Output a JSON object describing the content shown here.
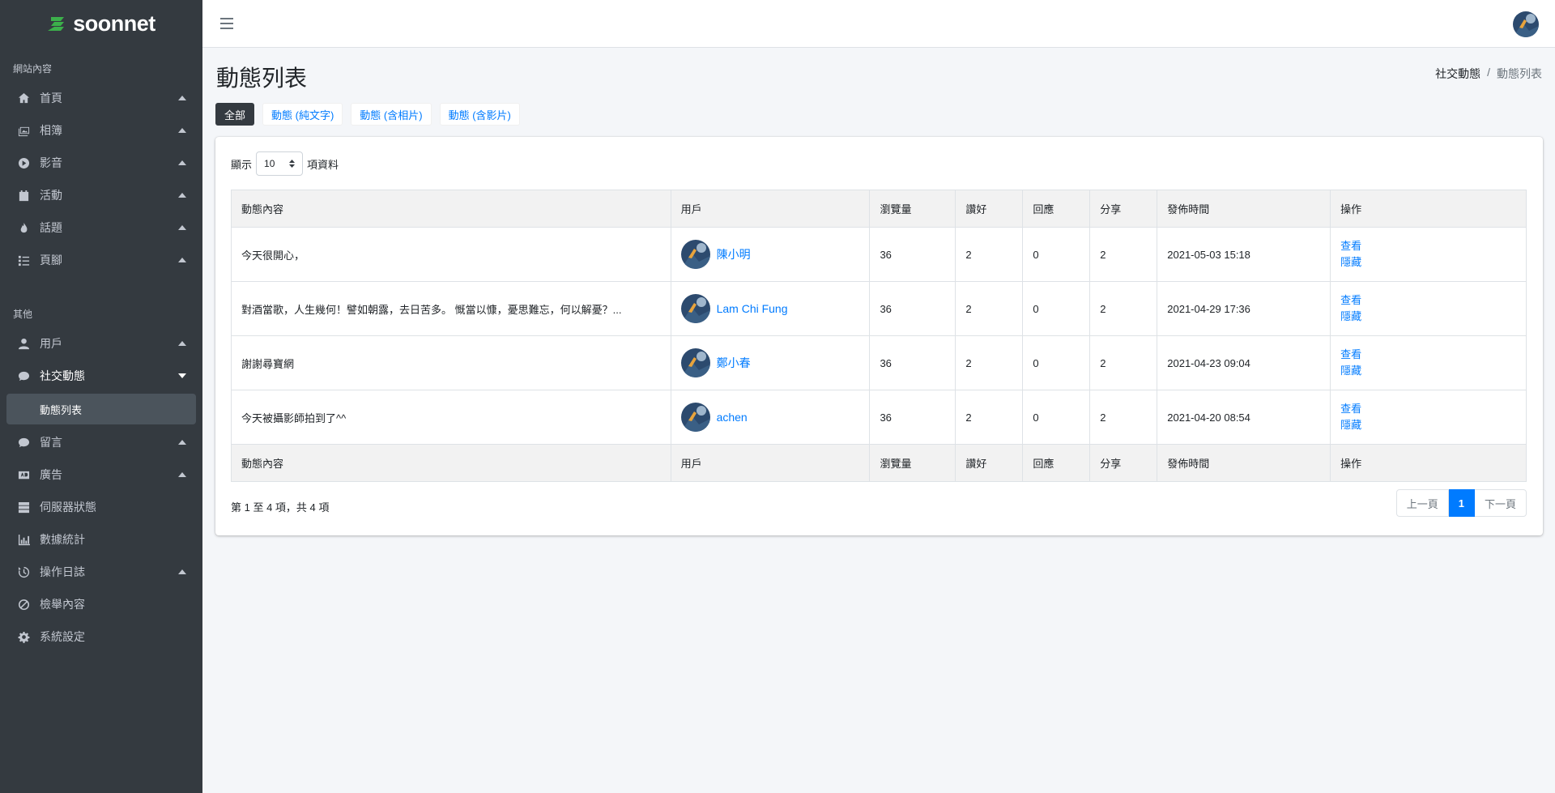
{
  "brand": {
    "name": "soonnet"
  },
  "sidebar": {
    "section1": "網站內容",
    "section2": "其他",
    "items1": [
      {
        "label": "首頁",
        "icon": "home-icon"
      },
      {
        "label": "相簿",
        "icon": "album-icon"
      },
      {
        "label": "影音",
        "icon": "play-circle-icon"
      },
      {
        "label": "活動",
        "icon": "calendar-icon"
      },
      {
        "label": "話題",
        "icon": "fire-icon"
      },
      {
        "label": "頁腳",
        "icon": "list-icon"
      }
    ],
    "items2": [
      {
        "label": "用戶",
        "icon": "user-icon"
      },
      {
        "label": "社交動態",
        "icon": "comment-icon"
      },
      {
        "label": "動態列表"
      },
      {
        "label": "留言",
        "icon": "comment-icon"
      },
      {
        "label": "廣告",
        "icon": "ad-icon"
      },
      {
        "label": "伺服器狀態",
        "icon": "server-icon"
      },
      {
        "label": "數據統計",
        "icon": "chart-icon"
      },
      {
        "label": "操作日誌",
        "icon": "history-icon"
      },
      {
        "label": "檢舉內容",
        "icon": "ban-icon"
      },
      {
        "label": "系統設定",
        "icon": "gear-icon"
      }
    ]
  },
  "page": {
    "title": "動態列表",
    "breadcrumb": [
      "社交動態",
      "/",
      "動態列表"
    ]
  },
  "filters": [
    "全部",
    "動態 (純文字)",
    "動態 (含相片)",
    "動態 (含影片)"
  ],
  "table": {
    "show_prefix": "顯示",
    "show_value": "10",
    "show_suffix": "項資料",
    "columns": [
      "動態內容",
      "用戶",
      "瀏覽量",
      "讚好",
      "回應",
      "分享",
      "發佈時間",
      "操作"
    ],
    "rows": [
      {
        "content": "今天很開心，",
        "user": "陳小明",
        "views": "36",
        "likes": "2",
        "replies": "0",
        "shares": "2",
        "time": "2021-05-03 15:18",
        "view": "查看",
        "hide": "隱藏"
      },
      {
        "content": "對酒當歌，人生幾何！譬如朝露，去日苦多。 慨當以慷，憂思難忘，何以解憂？...",
        "user": "Lam Chi Fung",
        "views": "36",
        "likes": "2",
        "replies": "0",
        "shares": "2",
        "time": "2021-04-29 17:36",
        "view": "查看",
        "hide": "隱藏"
      },
      {
        "content": "謝謝尋寶網",
        "user": "鄭小春",
        "views": "36",
        "likes": "2",
        "replies": "0",
        "shares": "2",
        "time": "2021-04-23 09:04",
        "view": "查看",
        "hide": "隱藏"
      },
      {
        "content": "今天被攝影師拍到了^^",
        "user": "achen",
        "views": "36",
        "likes": "2",
        "replies": "0",
        "shares": "2",
        "time": "2021-04-20 08:54",
        "view": "查看",
        "hide": "隱藏"
      }
    ],
    "info": "第 1 至 4 項，共 4 項",
    "pagination": {
      "prev": "上一頁",
      "current": "1",
      "next": "下一頁"
    }
  },
  "colors": {
    "sidebar_bg": "#343a40",
    "accent": "#007bff",
    "brand_green": "#3cb04b"
  }
}
